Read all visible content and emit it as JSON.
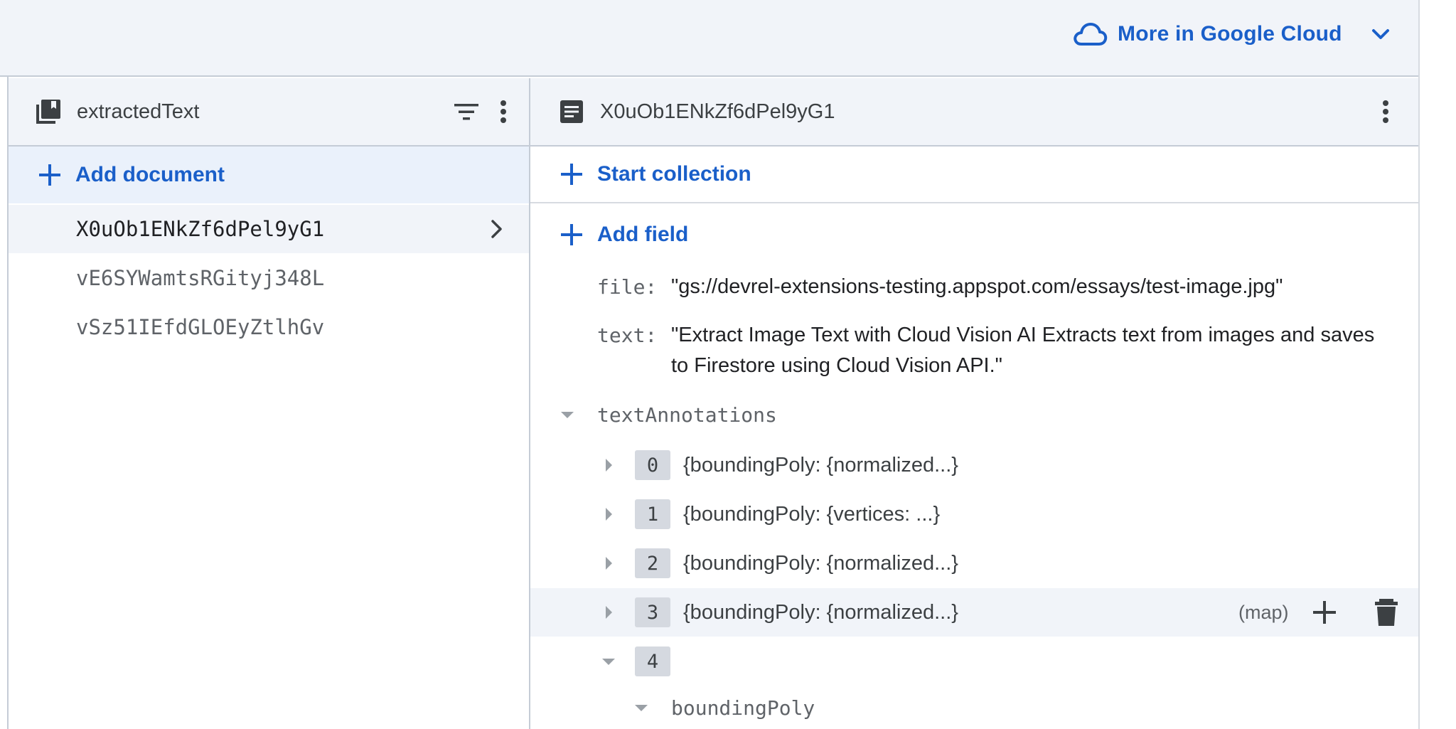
{
  "topbar": {
    "cloud_button_label": "More in Google Cloud"
  },
  "collection_panel": {
    "title": "extractedText",
    "add_document_label": "Add document",
    "documents": [
      {
        "id": "X0uOb1ENkZf6dPel9yG1",
        "selected": true
      },
      {
        "id": "vE6SYWamtsRGityj348L",
        "selected": false
      },
      {
        "id": "vSz51IEfdGLOEyZtlhGv",
        "selected": false
      }
    ]
  },
  "document_panel": {
    "title": "X0uOb1ENkZf6dPel9yG1",
    "start_collection_label": "Start collection",
    "add_field_label": "Add field",
    "fields": {
      "file": {
        "key": "file:",
        "value": "\"gs://devrel-extensions-testing.appspot.com/essays/test-image.jpg\""
      },
      "text": {
        "key": "text:",
        "value": "\"Extract Image Text with Cloud Vision AI Extracts text from images and saves to Firestore using Cloud Vision API.\""
      }
    },
    "text_annotations": {
      "key": "textAnnotations",
      "items": [
        {
          "index": "0",
          "summary": "{boundingPoly: {normalized...}"
        },
        {
          "index": "1",
          "summary": "{boundingPoly: {vertices: ...}"
        },
        {
          "index": "2",
          "summary": "{boundingPoly: {normalized...}"
        },
        {
          "index": "3",
          "summary": "{boundingPoly: {normalized...}",
          "type": "(map)"
        },
        {
          "index": "4",
          "summary": ""
        }
      ],
      "child_key": "boundingPoly"
    }
  },
  "colors": {
    "accent": "#1a5fc9",
    "header_bg": "#f1f4f9",
    "selected_bg": "#eaf1fb"
  }
}
